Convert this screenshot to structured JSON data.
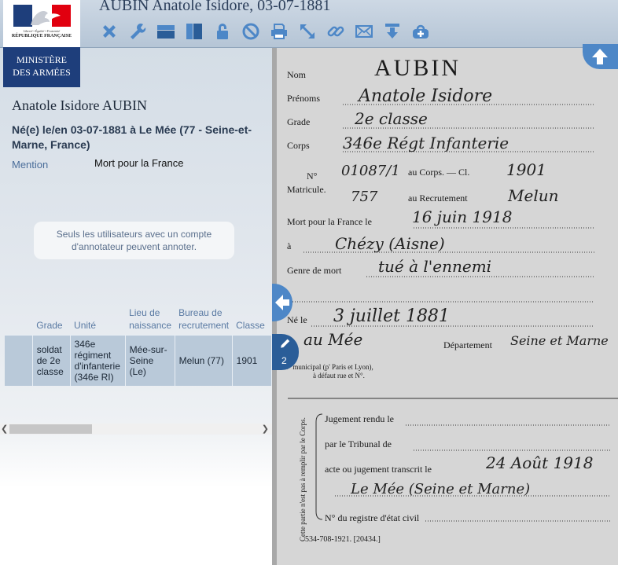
{
  "header": {
    "title": "AUBIN Anatole Isidore, 03-07-1881",
    "toolbar": [
      {
        "name": "close-icon",
        "color": "#4d87c7"
      },
      {
        "name": "wrench-icon",
        "color": "#4d87c7"
      },
      {
        "name": "horizontal-layout-icon",
        "color": "#4d87c7"
      },
      {
        "name": "vertical-layout-icon",
        "color": "#4d87c7"
      },
      {
        "name": "lock-icon",
        "color": "#4d87c7"
      },
      {
        "name": "forbidden-icon",
        "color": "#4d87c7"
      },
      {
        "name": "print-icon",
        "color": "#4d87c7"
      },
      {
        "name": "expand-icon",
        "color": "#4d87c7"
      },
      {
        "name": "link-icon",
        "color": "#4d87c7"
      },
      {
        "name": "mail-icon",
        "color": "#4d87c7"
      },
      {
        "name": "download-icon",
        "color": "#4d87c7"
      },
      {
        "name": "add-to-basket-icon",
        "color": "#4d87c7"
      }
    ]
  },
  "logo": {
    "motto": "Liberté • Égalité • Fraternité",
    "republic": "RÉPUBLIQUE FRANÇAISE",
    "ministry_line1": "MINISTÈRE",
    "ministry_line2": "DES ARMÉES"
  },
  "record": {
    "name": "Anatole Isidore AUBIN",
    "birth": "Né(e) le/en 03-07-1881 à Le Mée (77 - Seine-et-Marne, France)",
    "mention_label": "Mention",
    "mention_value": "Mort pour la France",
    "notice": "Seuls les utilisateurs avec un compte d'annotateur peuvent annoter."
  },
  "table": {
    "headers": [
      "",
      "Grade",
      "Unité",
      "Lieu de naissance",
      "Bureau de recrutement",
      "Classe"
    ],
    "rows": [
      [
        "",
        "soldat de 2e classe",
        "346e régiment d'infanterie (346e RI)",
        "Mée-sur-Seine (Le)",
        "Melun (77)",
        "1901"
      ]
    ]
  },
  "annotations": {
    "count": "2"
  },
  "document": {
    "name": "AUBIN",
    "labels": {
      "nom": "Nom",
      "prenoms": "Prénoms",
      "grade": "Grade",
      "corps": "Corps",
      "no": "N°",
      "matricule": "Matricule.",
      "au_corps": "au Corps. — Cl.",
      "au_recrutement": "au Recrutement",
      "mort": "Mort pour la France le",
      "a": "à",
      "genre": "Genre de mort",
      "ne_le": "Né le",
      "departement": "Département",
      "municipal": "N° municipal (p' Paris et Lyon),",
      "defaut": "à défaut rue et N°.",
      "jugement": "Jugement rendu le",
      "tribunal": "par le Tribunal de",
      "acte": "acte ou jugement transcrit le",
      "registre": "N° du registre d'état civil",
      "side_note": "Cette partie n'est pas à remplir par le Corps.",
      "footer": "534-708-1921. [20434.]"
    },
    "handwriting": {
      "prenoms": "Anatole Isidore",
      "grade": "2e classe",
      "corps": "346e Régt Infanterie",
      "numero": "01087/1",
      "classe": "1901",
      "recrutement_no": "757",
      "recrutement": "Melun",
      "date_mort": "16 juin 1918",
      "lieu_mort": "Chézy (Aisne)",
      "genre": "tué à l'ennemi",
      "date_naissance": "3 juillet 1881",
      "lieu_naissance": "au Mée",
      "departement": "Seine et Marne",
      "transcrit": "24 Août 1918",
      "transcrit_lieu": "Le Mée (Seine et Marne)"
    }
  }
}
